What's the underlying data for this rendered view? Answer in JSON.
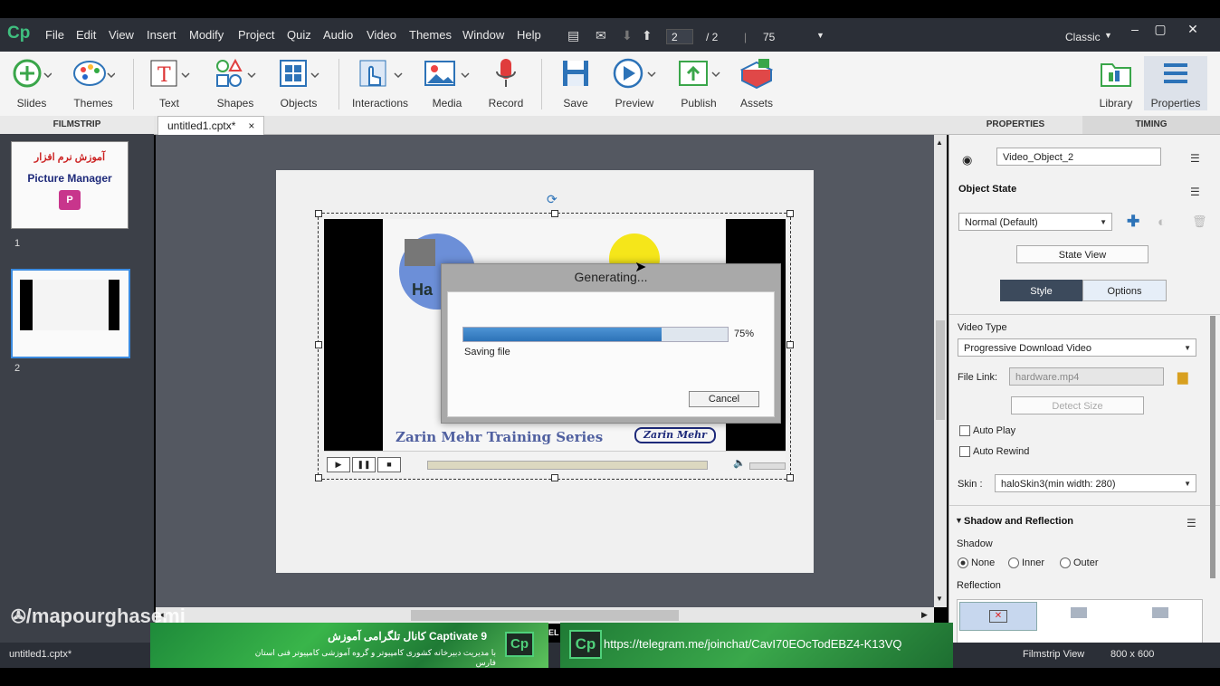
{
  "app": {
    "logo": "Cp",
    "workspace": "Classic"
  },
  "menu": [
    "File",
    "Edit",
    "View",
    "Insert",
    "Modify",
    "Project",
    "Quiz",
    "Audio",
    "Video",
    "Themes",
    "Window",
    "Help"
  ],
  "nav": {
    "current_page": "2",
    "separator": "/ 2",
    "zoom": "75"
  },
  "toolbar": {
    "slides": "Slides",
    "themes": "Themes",
    "text": "Text",
    "shapes": "Shapes",
    "objects": "Objects",
    "interactions": "Interactions",
    "media": "Media",
    "record": "Record",
    "save": "Save",
    "preview": "Preview",
    "publish": "Publish",
    "assets": "Assets",
    "library": "Library",
    "properties": "Properties"
  },
  "filmstrip": {
    "header": "FILMSTRIP",
    "slides": [
      {
        "number": "1",
        "title_fa": "آموزش نرم افزار",
        "title_en": "Picture Manager"
      },
      {
        "number": "2"
      }
    ]
  },
  "tabs": {
    "doc": "untitled1.cptx*",
    "close": "×"
  },
  "video_content": {
    "series": "Zarin Mehr Training Series",
    "brand": "Zarin Mehr",
    "partial_title": "Ha"
  },
  "dialog": {
    "title": "Generating...",
    "progress_label": "75%",
    "progress_value": 0.75,
    "status": "Saving file",
    "cancel": "Cancel"
  },
  "properties": {
    "tab_properties": "PROPERTIES",
    "tab_timing": "TIMING",
    "object_name": "Video_Object_2",
    "object_state_label": "Object State",
    "state_value": "Normal (Default)",
    "state_view": "State View",
    "style_tab": "Style",
    "options_tab": "Options",
    "video_type_label": "Video Type",
    "video_type_value": "Progressive Download Video",
    "file_link_label": "File Link:",
    "file_link_value": "hardware.mp4",
    "detect_size": "Detect Size",
    "auto_play": "Auto Play",
    "auto_rewind": "Auto Rewind",
    "skin_label": "Skin :",
    "skin_value": "haloSkin3(min width: 280)",
    "shadow_section": "Shadow and Reflection",
    "shadow_label": "Shadow",
    "shadow_none": "None",
    "shadow_inner": "Inner",
    "shadow_outer": "Outer",
    "reflection_label": "Reflection"
  },
  "status": {
    "file": "untitled1.cptx*",
    "view": "Filmstrip View",
    "size": "800 x 600"
  },
  "overlay": {
    "watermark": "/mapourghasemi",
    "banner_title": "کانال تلگرامی آموزش Captivate 9",
    "banner_sub": "با مدیریت دبیرخانه کشوری کامپیوتر و گروه آموزشی کامپیوتر فنی استان فارس",
    "banner_logo": "Cp",
    "telegram_url": "https://telegram.me/joinchat/CavI70EOcTodEBZ4-K13VQ",
    "el_text": "EL"
  },
  "colors": {
    "accent": "#2d73b8",
    "menubar": "#2b2f37",
    "stage": "#545861",
    "banner": "#39b54a"
  }
}
